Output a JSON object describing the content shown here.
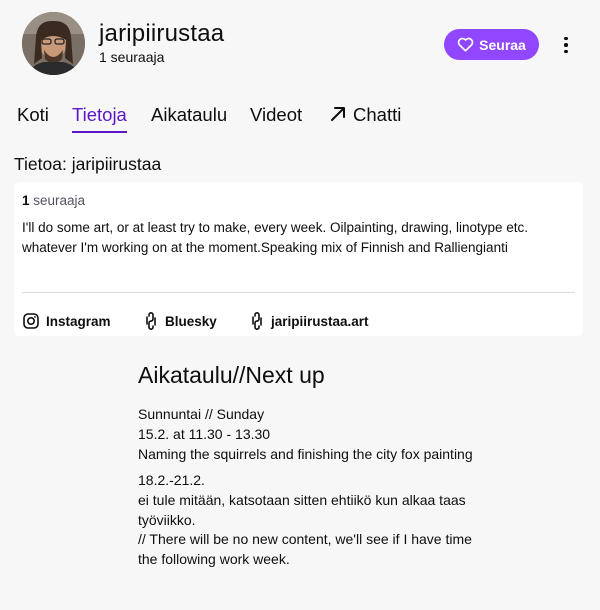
{
  "channel": {
    "username": "jaripiirustaa",
    "followers_text": "1 seuraaja"
  },
  "actions": {
    "follow_label": "Seuraa"
  },
  "tabs": [
    {
      "label": "Koti"
    },
    {
      "label": "Tietoja",
      "active": true
    },
    {
      "label": "Aikataulu"
    },
    {
      "label": "Videot"
    },
    {
      "label": "Chatti",
      "icon": "external-arrow-icon"
    }
  ],
  "about": {
    "title": "Tietoa: jaripiirustaa",
    "follower_count": "1",
    "follower_word": "seuraaja",
    "bio": "I'll do some art, or at least try to make, every week. Oilpainting, drawing, linotype etc. whatever I'm working on at the moment.Speaking mix of Finnish and Ralliengianti",
    "links": [
      {
        "label": "Instagram",
        "icon": "instagram-icon"
      },
      {
        "label": "Bluesky",
        "icon": "link-icon"
      },
      {
        "label": "jaripiirustaa.art",
        "icon": "link-icon"
      }
    ]
  },
  "panel": {
    "title": "Aikataulu//Next up",
    "paragraphs": [
      "Sunnuntai // Sunday\n15.2. at 11.30 - 13.30\nNaming the squirrels and finishing the city fox painting",
      "18.2.-21.2.\nei tule mitään, katsotaan sitten ehtiikö kun alkaa taas työviikko.\n// There will be no new content, we'll see if I have time the following work week."
    ]
  },
  "colors": {
    "accent": "#9147ff",
    "active_tab": "#5c16c5"
  }
}
